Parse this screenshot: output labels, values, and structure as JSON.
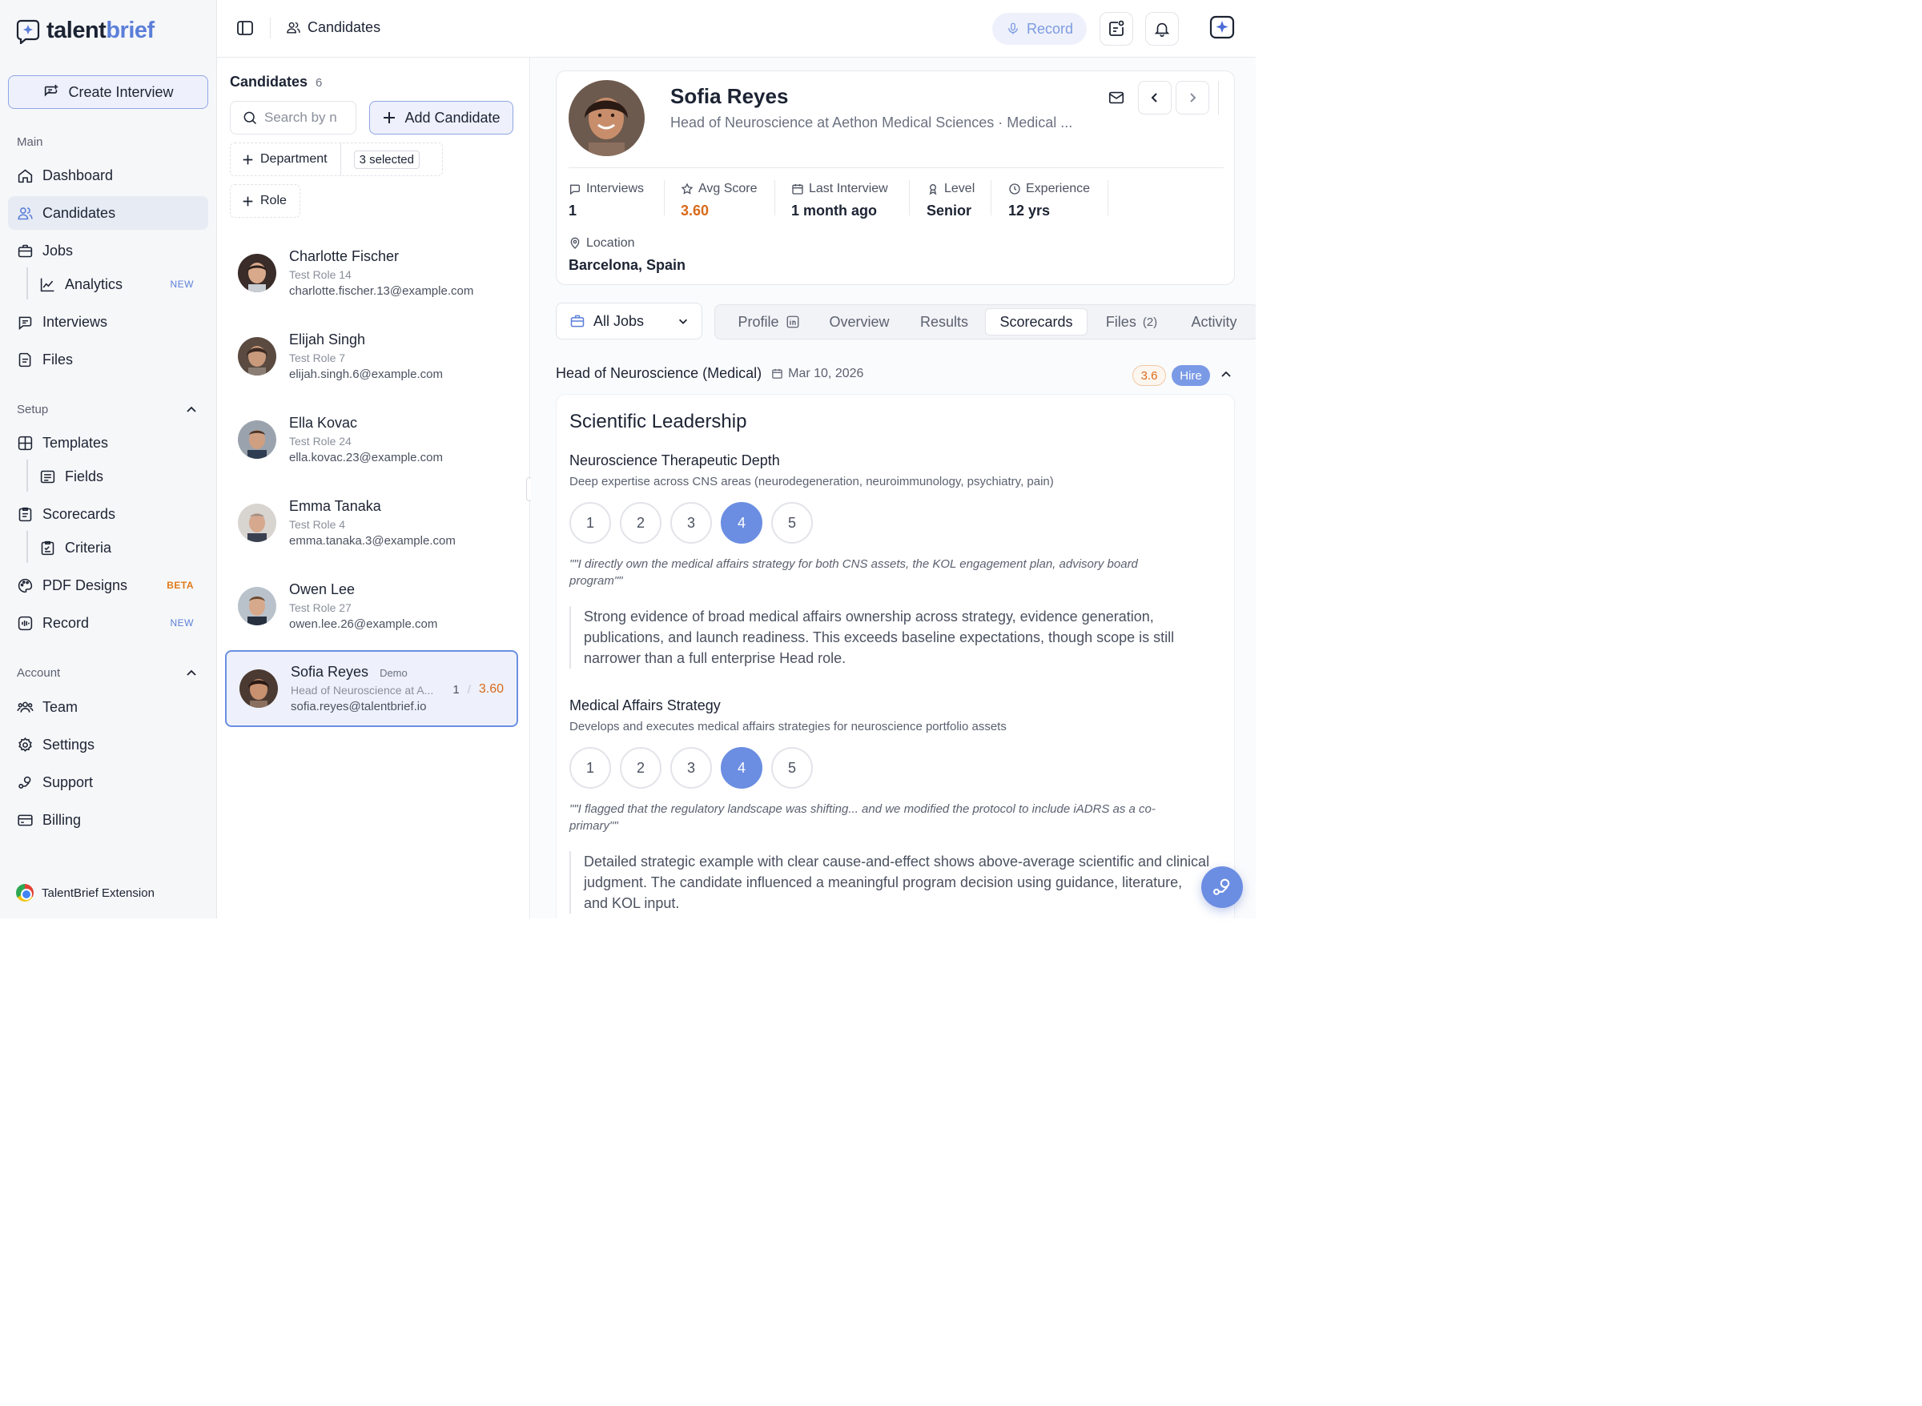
{
  "brand": {
    "name_part1": "talent",
    "name_part2": "brief"
  },
  "sidebar": {
    "create_label": "Create Interview",
    "main_label": "Main",
    "setup_label": "Setup",
    "account_label": "Account",
    "items": {
      "dashboard": "Dashboard",
      "candidates": "Candidates",
      "jobs": "Jobs",
      "analytics": "Analytics",
      "analytics_badge": "NEW",
      "interviews": "Interviews",
      "files": "Files",
      "templates": "Templates",
      "fields": "Fields",
      "scorecards": "Scorecards",
      "criteria": "Criteria",
      "pdf_designs": "PDF Designs",
      "pdf_badge": "BETA",
      "record": "Record",
      "record_badge": "NEW",
      "team": "Team",
      "settings": "Settings",
      "support": "Support",
      "billing": "Billing"
    },
    "extension_label": "TalentBrief Extension"
  },
  "topbar": {
    "breadcrumb": "Candidates",
    "record_label": "Record"
  },
  "list": {
    "title": "Candidates",
    "count": "6",
    "search_placeholder": "Search by n",
    "add_label": "Add Candidate",
    "filter_department": "Department",
    "filter_selected": "3 selected",
    "filter_role": "Role",
    "candidates": [
      {
        "name": "Charlotte Fischer",
        "role": "Test Role 14",
        "email": "charlotte.fischer.13@example.com"
      },
      {
        "name": "Elijah Singh",
        "role": "Test Role 7",
        "email": "elijah.singh.6@example.com"
      },
      {
        "name": "Ella Kovac",
        "role": "Test Role 24",
        "email": "ella.kovac.23@example.com"
      },
      {
        "name": "Emma Tanaka",
        "role": "Test Role 4",
        "email": "emma.tanaka.3@example.com"
      },
      {
        "name": "Owen Lee",
        "role": "Test Role 27",
        "email": "owen.lee.26@example.com"
      },
      {
        "name": "Sofia Reyes",
        "tag": "Demo",
        "role": "Head of Neuroscience at A...",
        "email": "sofia.reyes@talentbrief.io",
        "interviews": "1",
        "sep": "/",
        "score": "3.60"
      }
    ]
  },
  "profile": {
    "name": "Sofia Reyes",
    "title": "Head of Neuroscience at Aethon Medical Sciences · Medical ...",
    "stats": {
      "interviews_label": "Interviews",
      "interviews_value": "1",
      "avg_label": "Avg Score",
      "avg_value": "3.60",
      "last_label": "Last Interview",
      "last_value": "1 month ago",
      "level_label": "Level",
      "level_value": "Senior",
      "exp_label": "Experience",
      "exp_value": "12 yrs",
      "location_label": "Location",
      "location_value": "Barcelona, Spain"
    }
  },
  "tabs": {
    "jobs_select": "All Jobs",
    "profile": "Profile",
    "overview": "Overview",
    "results": "Results",
    "scorecards": "Scorecards",
    "files": "Files",
    "files_count": "(2)",
    "activity": "Activity"
  },
  "scorecard": {
    "job_title": "Head of Neuroscience (Medical)",
    "date": "Mar 10, 2026",
    "score": "3.6",
    "decision": "Hire",
    "section": "Scientific Leadership",
    "criteria": [
      {
        "name": "Neuroscience Therapeutic Depth",
        "description": "Deep expertise across CNS areas (neurodegeneration, neuroimmunology, psychiatry, pain)",
        "rating": 4,
        "quote": "\"\"I directly own the medical affairs strategy for both CNS assets, the KOL engagement plan, advisory board program\"\"",
        "note": "Strong evidence of broad medical affairs ownership across strategy, evidence generation, publications, and launch readiness. This exceeds baseline expectations, though scope is still narrower than a full enterprise Head role."
      },
      {
        "name": "Medical Affairs Strategy",
        "description": "Develops and executes medical affairs strategies for neuroscience portfolio assets",
        "rating": 4,
        "quote": "\"\"I flagged that the regulatory landscape was shifting... and we modified the protocol to include iADRS as a co-primary\"\"",
        "note": "Detailed strategic example with clear cause-and-effect shows above-average scientific and clinical judgment. The candidate influenced a meaningful program decision using guidance, literature, and KOL input."
      }
    ],
    "scale": [
      "1",
      "2",
      "3",
      "4",
      "5"
    ]
  },
  "colors": {
    "accent": "#6b8ee2",
    "brand_blue": "#5b7fd9",
    "score_orange": "#d96a1a"
  }
}
